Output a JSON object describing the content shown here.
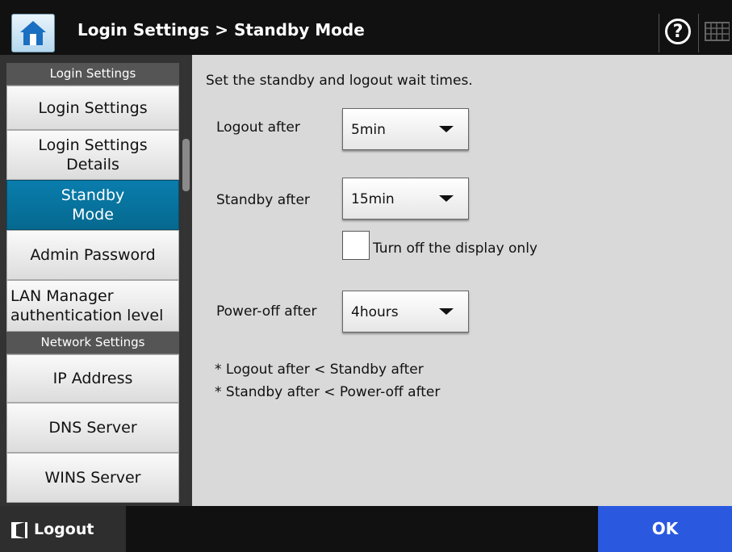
{
  "header": {
    "title": "Login Settings > Standby Mode",
    "help_symbol": "?"
  },
  "sidebar": {
    "sections": [
      {
        "label": "Login Settings"
      },
      {
        "label": "Network Settings"
      }
    ],
    "items": [
      {
        "label": "Login Settings"
      },
      {
        "label": "Login Settings Details"
      },
      {
        "label": "Standby Mode",
        "active": true
      },
      {
        "label": "Admin Password"
      },
      {
        "label": "LAN Manager authentication level"
      },
      {
        "label": "IP Address"
      },
      {
        "label": "DNS Server"
      },
      {
        "label": "WINS Server"
      }
    ]
  },
  "main": {
    "description": "Set the standby and logout wait times.",
    "logout": {
      "label": "Logout after",
      "value": "5min"
    },
    "standby": {
      "label": "Standby after",
      "value": "15min"
    },
    "display_only": {
      "label": "Turn off the display only",
      "checked": false
    },
    "poweroff": {
      "label": "Power-off after",
      "value": "4hours"
    },
    "notes": [
      "* Logout after < Standby after",
      "* Standby after < Power-off after"
    ]
  },
  "footer": {
    "logout_label": "Logout",
    "ok_label": "OK"
  },
  "colors": {
    "header_bg": "#111111",
    "active_item": "#0a7dad",
    "ok_button": "#2a59e0",
    "panel_bg": "#d9d9d9"
  },
  "icons": [
    "home-icon",
    "help-icon",
    "keyboard-icon",
    "logout-icon",
    "chevron-down-icon"
  ]
}
